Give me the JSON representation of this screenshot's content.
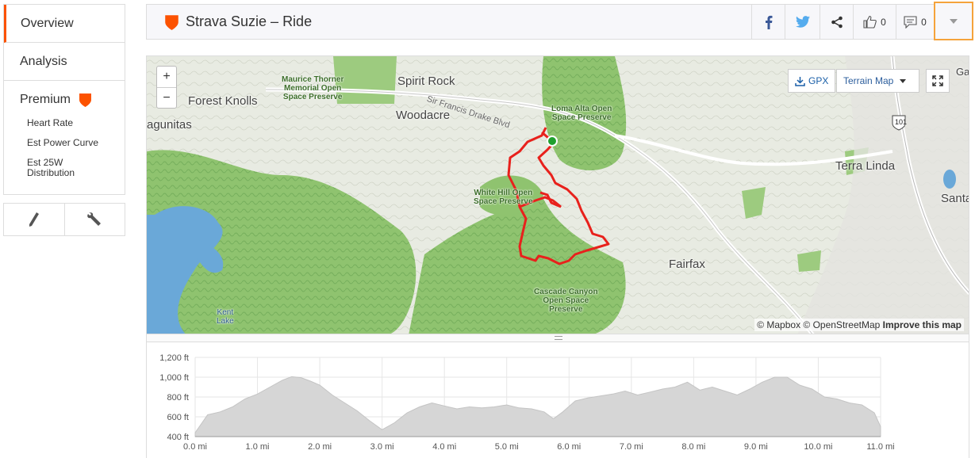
{
  "sidebar": {
    "nav": [
      {
        "label": "Overview",
        "active": true
      },
      {
        "label": "Analysis",
        "active": false
      }
    ],
    "premium": {
      "label": "Premium",
      "items": [
        "Heart Rate",
        "Est Power Curve",
        "Est 25W Distribution"
      ]
    },
    "tools": [
      "pencil-icon",
      "wrench-icon"
    ]
  },
  "header": {
    "title": "Strava Suzie – Ride",
    "kudos_count": "0",
    "comments_count": "0",
    "accent": "#fc5200"
  },
  "map": {
    "zoom_in": "+",
    "zoom_out": "−",
    "gpx_label": "GPX",
    "style_label": "Terrain Map",
    "attribution": "© Mapbox © OpenStreetMap",
    "improve": "Improve this map",
    "places": {
      "forest_knolls": "Forest Knolls",
      "spirit_rock": "Spirit Rock",
      "woodacre": "Woodacre",
      "lagunitas": "agunitas",
      "terra_linda": "Terra Linda",
      "fairfax": "Fairfax",
      "santa": "Santa",
      "ga": "Ga"
    },
    "parks": {
      "maurice": "Maurice Thorner\nMemorial Open\nSpace Preserve",
      "loma_alta": "Loma Alta Open\nSpace Preserve",
      "white_hill": "White Hill Open\nSpace Preserve",
      "cascade": "Cascade Canyon\nOpen Space\nPreserve",
      "kent_lake": "Kent\nLake"
    },
    "road": "Sir Francis Drake Blvd",
    "highway": "101",
    "route_color": "#e8211c",
    "start_color": "#1fa02e"
  },
  "chart_data": {
    "type": "area",
    "ylabel": "",
    "xlabel": "",
    "yticks": [
      "400 ft",
      "600 ft",
      "800 ft",
      "1,000 ft",
      "1,200 ft"
    ],
    "xticks": [
      "0.0 mi",
      "1.0 mi",
      "2.0 mi",
      "3.0 mi",
      "4.0 mi",
      "5.0 mi",
      "6.0 mi",
      "7.0 mi",
      "8.0 mi",
      "9.0 mi",
      "10.0 mi",
      "11.0 mi"
    ],
    "ylim": [
      400,
      1200
    ],
    "xlim": [
      0,
      11
    ],
    "x": [
      0,
      0.2,
      0.4,
      0.6,
      0.8,
      1.0,
      1.2,
      1.4,
      1.55,
      1.7,
      1.85,
      2.0,
      2.2,
      2.4,
      2.6,
      2.8,
      3.0,
      3.2,
      3.4,
      3.6,
      3.8,
      4.0,
      4.2,
      4.4,
      4.6,
      4.8,
      5.0,
      5.2,
      5.4,
      5.6,
      5.75,
      5.9,
      6.1,
      6.3,
      6.5,
      6.7,
      6.9,
      7.1,
      7.3,
      7.5,
      7.7,
      7.9,
      8.1,
      8.3,
      8.5,
      8.7,
      8.9,
      9.1,
      9.3,
      9.5,
      9.7,
      9.9,
      10.1,
      10.3,
      10.5,
      10.7,
      10.9,
      11.0
    ],
    "y": [
      440,
      620,
      650,
      700,
      780,
      830,
      900,
      970,
      1005,
      995,
      960,
      920,
      820,
      740,
      660,
      560,
      470,
      540,
      640,
      700,
      740,
      710,
      680,
      700,
      690,
      700,
      720,
      690,
      680,
      650,
      580,
      650,
      760,
      790,
      810,
      830,
      860,
      820,
      850,
      880,
      900,
      950,
      870,
      900,
      860,
      820,
      880,
      950,
      1000,
      1000,
      920,
      880,
      800,
      780,
      740,
      720,
      640,
      500
    ],
    "fill": "#d6d6d6",
    "stroke": "#c4c4c4"
  }
}
